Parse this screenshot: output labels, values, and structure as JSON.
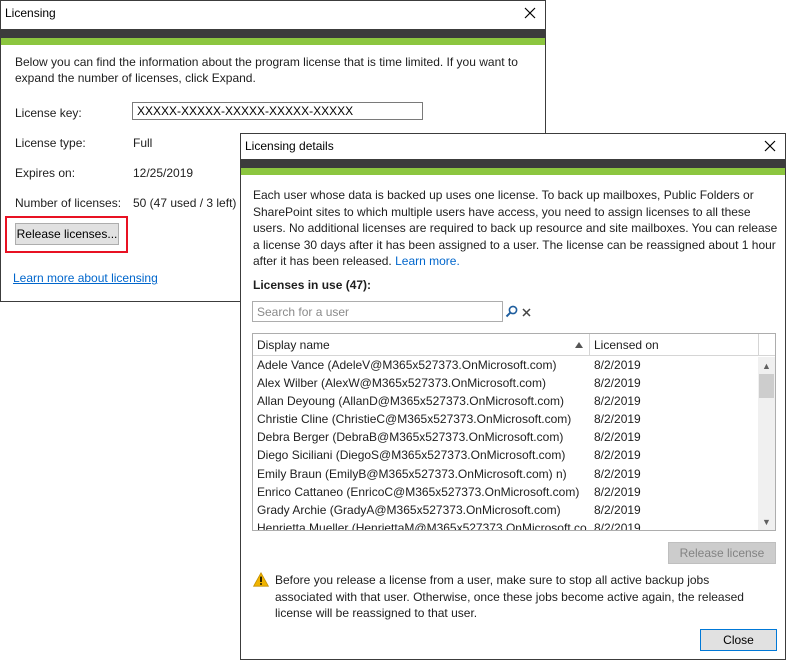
{
  "licensing": {
    "title": "Licensing",
    "intro": "Below you can find the information about the program license that is time limited. If you want to expand the number of licenses, click Expand.",
    "license_key_label": "License key:",
    "license_key_value": "XXXXX-XXXXX-XXXXX-XXXXX-XXXXX",
    "license_type_label": "License type:",
    "license_type_value": "Full",
    "expires_label": "Expires on:",
    "expires_value": "12/25/2019",
    "num_licenses_label": "Number of licenses:",
    "num_licenses_value": "50 (47 used / 3 left)",
    "release_button": "Release licenses...",
    "learn_more_link": "Learn more about licensing"
  },
  "details": {
    "title": "Licensing details",
    "description": "Each user whose data is backed up uses one license. To back up mailboxes, Public Folders or SharePoint sites to which multiple users have access, you need to assign licenses to all these users. No additional licenses are required to back up resource and site mailboxes. You can release a license 30 days after it has been assigned to a user. The license can be reassigned about 1 hour after it has been released.",
    "learn_more": "Learn more.",
    "in_use_heading": "Licenses in use (47):",
    "search_placeholder": "Search for a user",
    "columns": {
      "display_name": "Display name",
      "licensed_on": "Licensed on"
    },
    "rows": [
      {
        "name": "Adele Vance (AdeleV@M365x527373.OnMicrosoft.com)",
        "date": "8/2/2019"
      },
      {
        "name": "Alex Wilber (AlexW@M365x527373.OnMicrosoft.com)",
        "date": "8/2/2019"
      },
      {
        "name": "Allan Deyoung (AllanD@M365x527373.OnMicrosoft.com)",
        "date": "8/2/2019"
      },
      {
        "name": "Christie Cline (ChristieC@M365x527373.OnMicrosoft.com)",
        "date": "8/2/2019"
      },
      {
        "name": "Debra Berger (DebraB@M365x527373.OnMicrosoft.com)",
        "date": "8/2/2019"
      },
      {
        "name": "Diego Siciliani (DiegoS@M365x527373.OnMicrosoft.com)",
        "date": "8/2/2019"
      },
      {
        "name": "Emily Braun (EmilyB@M365x527373.OnMicrosoft.com) n)",
        "date": "8/2/2019"
      },
      {
        "name": "Enrico Cattaneo (EnricoC@M365x527373.OnMicrosoft.com)",
        "date": "8/2/2019"
      },
      {
        "name": "Grady Archie (GradyA@M365x527373.OnMicrosoft.com)",
        "date": "8/2/2019"
      },
      {
        "name": "Henrietta Mueller (HenriettaM@M365x527373.OnMicrosoft.co",
        "date": "8/2/2019"
      }
    ],
    "release_license_button": "Release license",
    "warning": "Before you release a license from a user, make sure to stop all active backup jobs associated with that user. Otherwise, once these jobs become active again, the released license will be reassigned to that user.",
    "close_button": "Close"
  },
  "colors": {
    "accent_green": "#8cc63f",
    "band_dark": "#3c3c3c",
    "link": "#0066cc",
    "highlight": "#e81123",
    "warning": "#f0b400"
  }
}
